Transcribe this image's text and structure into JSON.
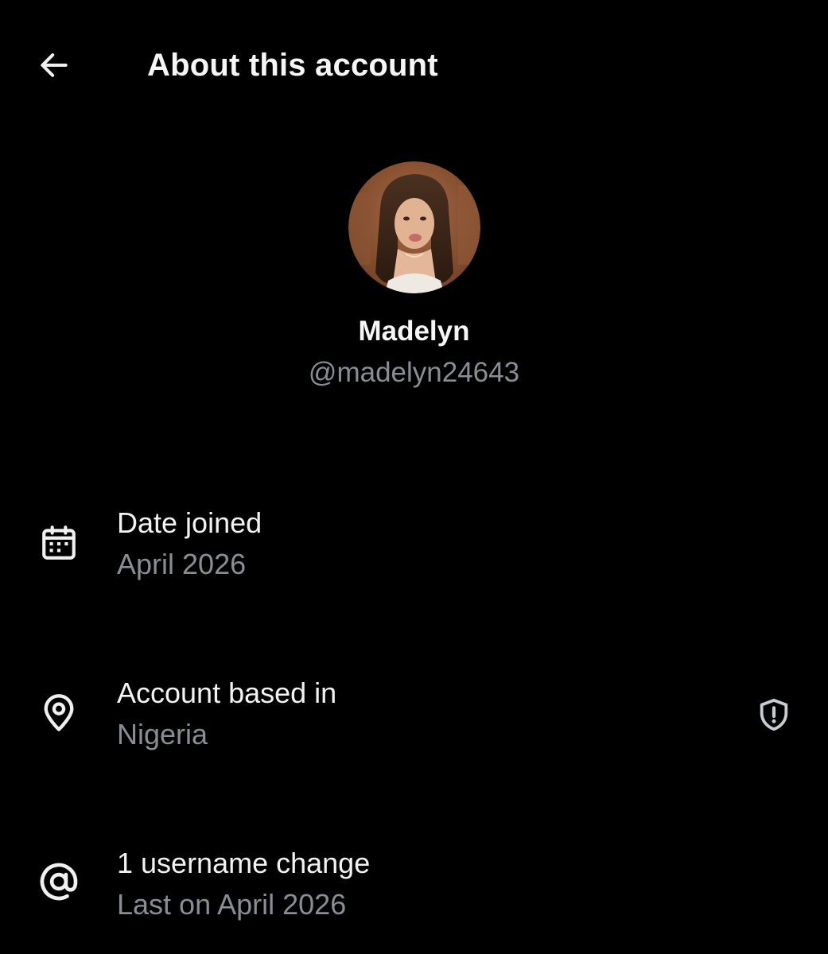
{
  "header": {
    "back_icon": "back-arrow-icon",
    "title": "About this account"
  },
  "profile": {
    "avatar_description": "profile photo",
    "display_name": "Madelyn",
    "handle": "@madelyn24643"
  },
  "details": [
    {
      "icon": "calendar-icon",
      "label": "Date joined",
      "value": "April 2026"
    },
    {
      "icon": "location-pin-icon",
      "label": "Account based in",
      "value": "Nigeria",
      "trailing_icon": "shield-alert-icon"
    },
    {
      "icon": "at-sign-icon",
      "label": "1 username change",
      "value": "Last on April 2026"
    }
  ],
  "colors": {
    "background": "#000000",
    "primary_text": "#f5f5f5",
    "secondary_text": "#8a8d92",
    "icon": "#f0f0f0",
    "trailing_icon": "#c9cccf"
  }
}
